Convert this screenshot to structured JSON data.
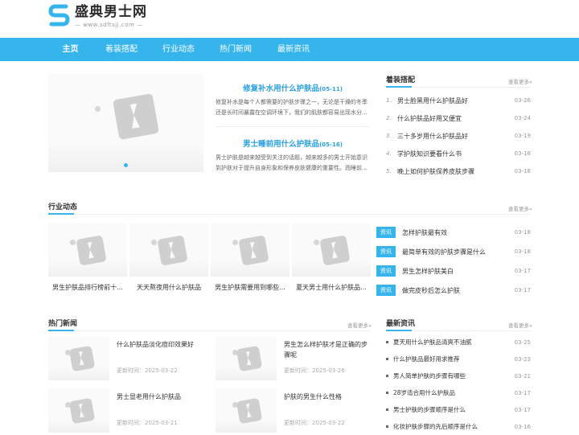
{
  "site": {
    "name": "盛典男士网",
    "url": "— www.sdftsjj.com —"
  },
  "nav": [
    "主页",
    "着装搭配",
    "行业动态",
    "热门新闻",
    "最新资讯"
  ],
  "lead": [
    {
      "title": "修复补水用什么护肤品",
      "date": "(05-11)",
      "desc": "修复补水是每个人都需要的护肤步骤之一，无论是干燥的冬季还是长时间暴露在空调环境下，我们的肌肤都容易出现水分..."
    },
    {
      "title": "男士睡前用什么护肤品",
      "date": "(05-16)",
      "desc": "男士护肤是越来越受到关注的话题，越来越多的男士开始意识到护肤对于提升自身形象和保养皮肤健康的重要性。而睡前..."
    }
  ],
  "dress": {
    "title": "着装搭配",
    "more": "查看更多»",
    "items": [
      {
        "num": "1.",
        "text": "男士脸黑用什么护肤品好",
        "date": "03-26"
      },
      {
        "num": "2.",
        "text": "什么护肤品好用又便宜",
        "date": "03-24"
      },
      {
        "num": "3.",
        "text": "三十多岁用什么护肤品好",
        "date": "03-19"
      },
      {
        "num": "4.",
        "text": "学护肤知识要看什么书",
        "date": "03-18"
      },
      {
        "num": "5.",
        "text": "晚上如何护肤保养皮肤步骤",
        "date": "03-18"
      }
    ]
  },
  "industry": {
    "title": "行业动态",
    "more": "查看更多»",
    "gallery": [
      "男生护肤品排行榜前十...",
      "天天熬夜用什么护肤品",
      "男生护肤需要用到哪些...",
      "夏天男士用什么护肤品..."
    ],
    "tag_label": "资讯",
    "items": [
      {
        "text": "怎样护肤最有效",
        "date": "03-18"
      },
      {
        "text": "最简单有效的护肤步骤是什么",
        "date": "03-18"
      },
      {
        "text": "男生怎样护肤美白",
        "date": "03-17"
      },
      {
        "text": "做完皮秒后怎么护肤",
        "date": "03-17"
      }
    ]
  },
  "hot": {
    "title": "热门新闻",
    "more": "查看更多»",
    "items": [
      {
        "title": "什么护肤品淡化痘印效果好",
        "time": "更新时间：2025-03-22"
      },
      {
        "title": "男生怎么样护肤才是正确的步骤呢",
        "time": "更新时间：2025-03-26"
      },
      {
        "title": "男士显老用什么护肤品",
        "time": "更新时间：2025-03-21"
      },
      {
        "title": "护肤的男生什么性格",
        "time": "更新时间：2025-03-22"
      }
    ]
  },
  "latest": {
    "title": "最新资讯",
    "more": "查看更多»",
    "items": [
      {
        "text": "夏天用什么护肤品清爽不油腻",
        "date": "03-25"
      },
      {
        "text": "什么护肤品最好用求推荐",
        "date": "03-23"
      },
      {
        "text": "男人简单护肤的步骤有哪些",
        "date": "03-21"
      },
      {
        "text": "28岁适合用什么护肤品",
        "date": "03-17"
      },
      {
        "text": "男士护肤的步骤顺序是什么",
        "date": "03-17"
      },
      {
        "text": "化妆护肤步骤的先后顺序是什么",
        "date": "03-16"
      }
    ]
  },
  "colors": {
    "accent": "#36b5ec",
    "lead_title": "#2aa0e0"
  }
}
